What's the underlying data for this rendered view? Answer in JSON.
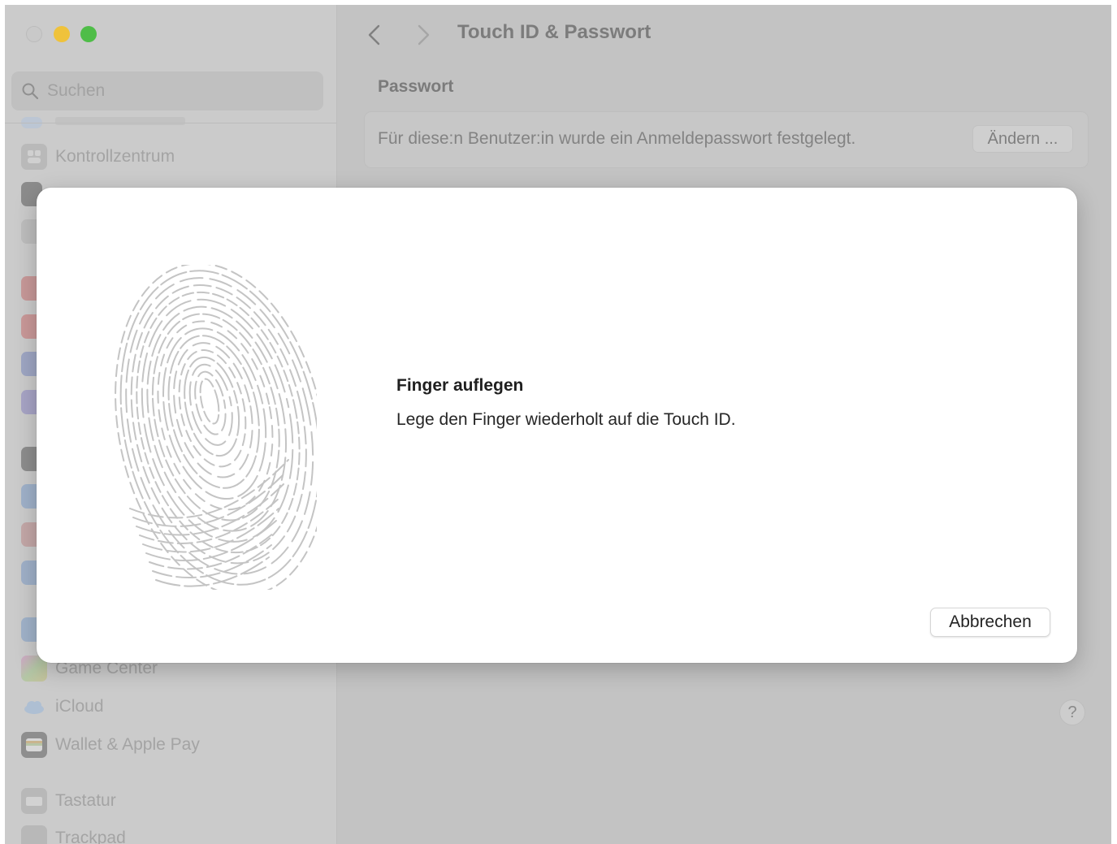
{
  "window": {
    "title": "Touch ID & Passwort"
  },
  "search": {
    "placeholder": "Suchen"
  },
  "sidebar": {
    "items": [
      {
        "label": "Kontrollzentrum",
        "icon": "control-center-icon"
      },
      {
        "label": "Game Center",
        "icon": "game-center-icon"
      },
      {
        "label": "iCloud",
        "icon": "icloud-icon"
      },
      {
        "label": "Wallet & Apple Pay",
        "icon": "wallet-icon"
      },
      {
        "label": "Tastatur",
        "icon": "keyboard-icon"
      },
      {
        "label": "Trackpad",
        "icon": "trackpad-icon"
      }
    ]
  },
  "main": {
    "section_title": "Passwort",
    "password_text": "Für diese:n Benutzer:in wurde ein Anmeldepasswort festgelegt.",
    "change_label": "Ändern ...",
    "help_label": "?"
  },
  "dialog": {
    "title": "Finger auflegen",
    "message": "Lege den Finger wiederholt auf die Touch ID.",
    "cancel_label": "Abbrechen"
  },
  "colors": {
    "traffic_min": "#efc23b",
    "traffic_max": "#4fbd48",
    "fingerprint": "#c4c4c4",
    "sheet_bg": "#ffffff",
    "dim_bg": "#c3c3c3"
  }
}
